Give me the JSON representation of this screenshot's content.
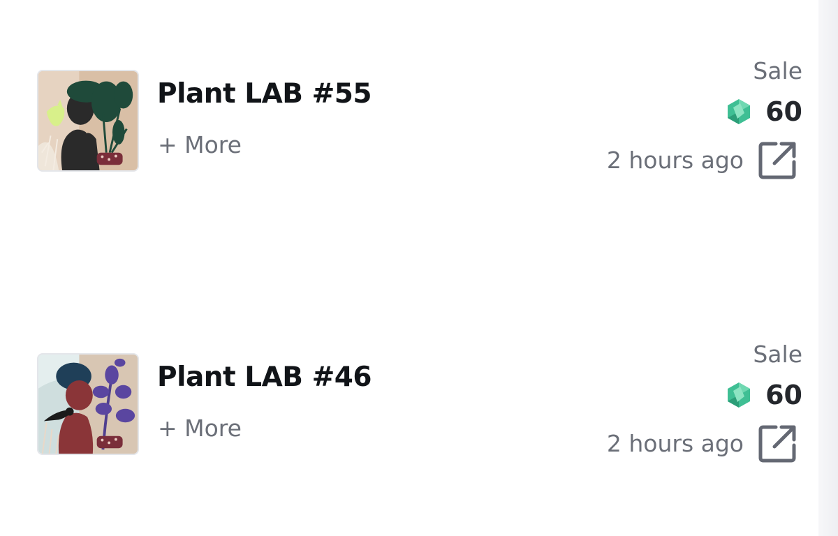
{
  "activity": [
    {
      "title": "Plant LAB #55",
      "more_label": "+ More",
      "event_type": "Sale",
      "price": "60",
      "time_ago": "2 hours ago",
      "token_icon": "token-icon",
      "link_icon": "external-link-icon"
    },
    {
      "title": "Plant LAB #46",
      "more_label": "+ More",
      "event_type": "Sale",
      "price": "60",
      "time_ago": "2 hours ago",
      "token_icon": "token-icon",
      "link_icon": "external-link-icon"
    }
  ],
  "colors": {
    "title": "#111418",
    "muted": "#6b6f78",
    "token": "#3fbf94"
  }
}
